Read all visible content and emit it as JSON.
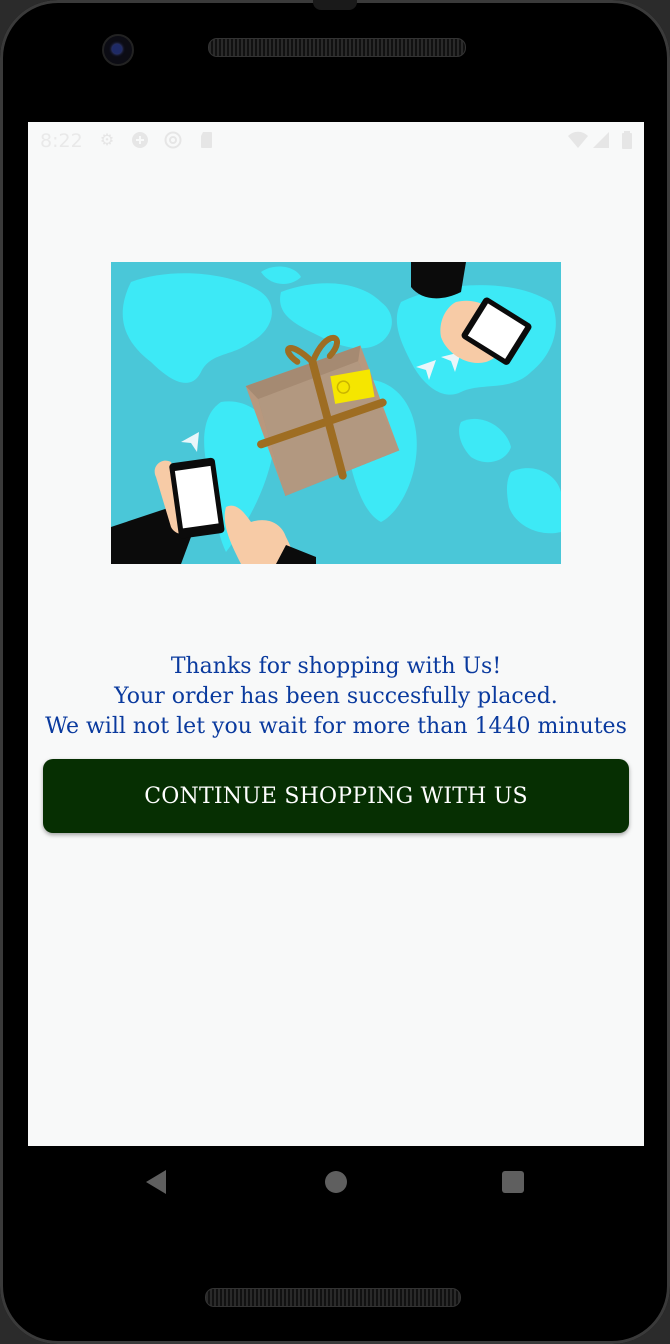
{
  "status_bar": {
    "time": "8:22",
    "left_icons": [
      "gear-icon",
      "shield-plus-icon",
      "at-sign-icon",
      "sd-card-icon"
    ],
    "right_icons": [
      "wifi-icon",
      "cellular-signal-icon",
      "battery-icon"
    ]
  },
  "hero": {
    "icon": "parcel-delivery-world-map-illustration"
  },
  "confirmation": {
    "line1": "Thanks for shopping with Us!",
    "line2": "Your order has been succesfully placed.",
    "line3": "We will not let you wait for more than 1440 minutes"
  },
  "actions": {
    "continue_label": "CONTINUE SHOPPING WITH US"
  },
  "colors": {
    "text_blue": "#0a3a9e",
    "button_green": "#062f02",
    "map_sea": "#4ac7d8",
    "map_land": "#3de9f6"
  },
  "navigation": {
    "back": "back-icon",
    "home": "home-icon",
    "recents": "recents-icon"
  }
}
